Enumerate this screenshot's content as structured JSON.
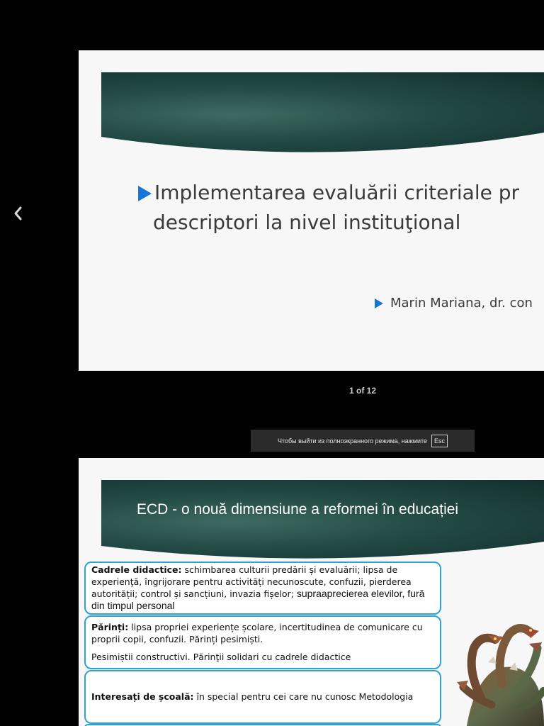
{
  "viewer": {
    "prev_icon": "chevron-left-icon",
    "page_counter": "1 of 12",
    "fullscreen_hint": {
      "text": "Чтобы выйти из полноэкранного режима, нажмите",
      "key": "Esc"
    }
  },
  "slide1": {
    "title_line1": "Implementarea evaluării criteriale pr",
    "title_line2": "descriptori la nivel instituţional",
    "author": "Marin Mariana, dr. con",
    "bullet_color": "#1a73d9"
  },
  "slide2": {
    "title": "ECD - o nouă dimensiune a reformei în educației",
    "boxes": [
      {
        "label": "Cadrele didactice:",
        "text": " schimbarea culturii predării și evaluării; lipsa de experienţă, îngrijorare pentru activități necunoscute, confuzii, pierderea autorității; control și sancțiuni, invazia fișelor; ",
        "text_large": "supraaprecierea elevilor, fură din timpul personal"
      },
      {
        "label": "Părinți:",
        "text": " lipsa propriei experiențe școlare, incertitudinea de comunicare cu proprii copii, confuzii. Părinți pesimiști.",
        "text2": "Pesimiștii constructivi. Părinţii solidari cu cadrele didactice"
      },
      {
        "label": "Interesați de școală:",
        "text": " în special pentru cei care nu cunosc Metodologia"
      }
    ],
    "box_border_color": "#2ba3d8"
  }
}
